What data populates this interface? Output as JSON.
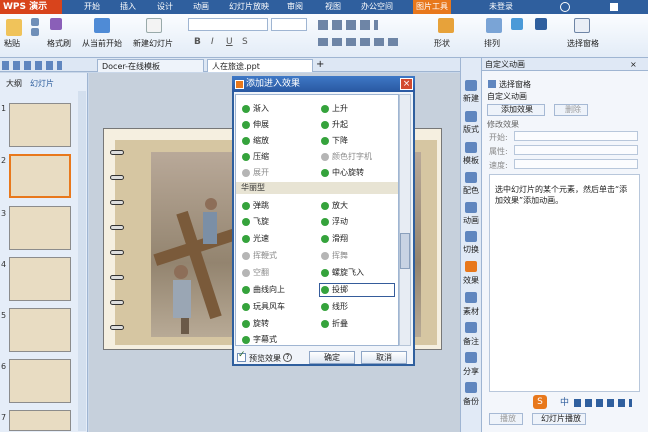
{
  "menubar": {
    "app_name": "WPS 演示",
    "items": [
      "开始",
      "插入",
      "设计",
      "动画",
      "幻灯片放映",
      "审阅",
      "视图",
      "办公空间",
      "图片工具"
    ],
    "user": "未登录"
  },
  "ribbon": {
    "paste": "粘贴",
    "format_painter": "格式刷",
    "from_current": "从当前开始",
    "new_slide": "新建幻灯片",
    "shape": "形状",
    "arrange": "排列",
    "select_pane": "选择窗格"
  },
  "doc_tabs": [
    "Docer-在线模板",
    "人在旅途.ppt"
  ],
  "left_panel": {
    "tabs": [
      "大纲",
      "幻灯片"
    ],
    "slide_numbers": [
      "1",
      "2",
      "3",
      "4",
      "5",
      "6",
      "7"
    ]
  },
  "dialog": {
    "title": "添加进入效果",
    "group_basic": [
      "渐入",
      "伸展",
      "缩放",
      "压缩",
      "展开",
      "上升",
      "升起",
      "下降",
      "颜色打字机",
      "中心旋转"
    ],
    "group_title": "华丽型",
    "group_fancy_left": [
      "弹跳",
      "飞旋",
      "光速",
      "挥鞭式",
      "空翻",
      "曲线向上",
      "玩具风车",
      "旋转",
      "字幕式"
    ],
    "group_fancy_right": [
      "放大",
      "浮动",
      "滑翔",
      "挥舞",
      "螺旋飞入",
      "投掷",
      "线形",
      "折叠"
    ],
    "preview_label": "预览效果",
    "ok": "确定",
    "cancel": "取消"
  },
  "right_strip": [
    "新建",
    "版式",
    "模板",
    "配色",
    "动画",
    "切换",
    "效果",
    "素材",
    "备注",
    "分享",
    "备份"
  ],
  "task_pane": {
    "title": "自定义动画",
    "select_pane": "选择窗格",
    "custom_anim": "自定义动画",
    "add_effect": "添加效果",
    "delete": "删除",
    "modify_effect": "修改效果",
    "start": "开始:",
    "property": "属性:",
    "speed": "速度:",
    "hint": "选中幻灯片的某个元素，然后单击“添加效果”添加动画。",
    "play": "播放",
    "slideshow": "幻灯片播放"
  },
  "tray": {
    "ime": "中"
  },
  "colors": {
    "accent": "#2f5f9e",
    "app": "#d8441c",
    "tool_tab": "#e8781c",
    "effect_icon": "#35a33c"
  }
}
